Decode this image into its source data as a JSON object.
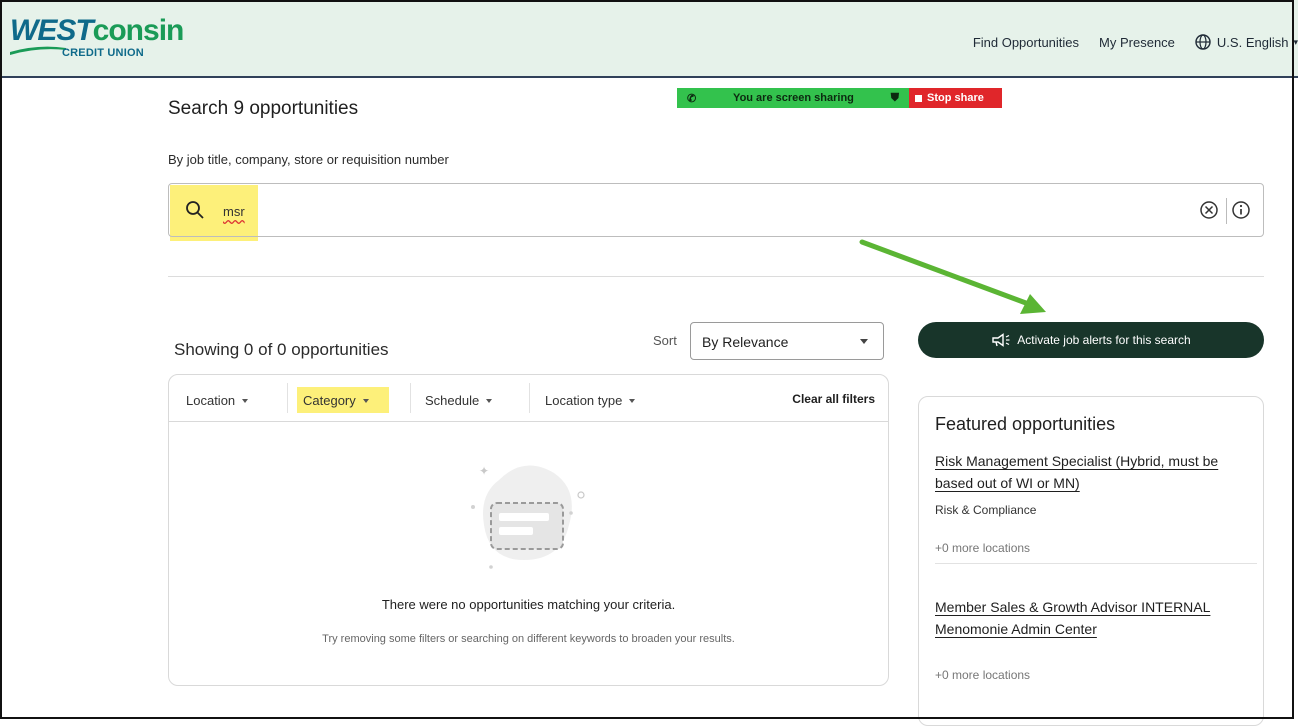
{
  "header": {
    "logo_main": "WEST",
    "logo_accent": "consin",
    "logo_sub": "CREDIT UNION",
    "nav": [
      "Find Opportunities",
      "My Presence"
    ],
    "language": "U.S. English"
  },
  "screen_share": {
    "status": "You are screen sharing",
    "stop": "Stop share"
  },
  "search": {
    "title": "Search 9 opportunities",
    "hint": "By job title, company, store or requisition number",
    "value": "msr"
  },
  "results": {
    "showing": "Showing 0 of 0 opportunities",
    "sort_label": "Sort",
    "sort_value": "By Relevance",
    "alerts_button": "Activate job alerts for this search",
    "filters": [
      "Location",
      "Category",
      "Schedule",
      "Location type"
    ],
    "clear_filters": "Clear all filters",
    "empty_title": "There were no opportunities matching your criteria.",
    "empty_sub": "Try removing some filters or searching on different keywords to broaden your results."
  },
  "featured": {
    "heading": "Featured opportunities",
    "jobs": [
      {
        "title": "Risk Management Specialist (Hybrid, must be based out of WI or MN)",
        "category": "Risk & Compliance",
        "locations": "+0 more locations"
      },
      {
        "title": "Member Sales & Growth Advisor INTERNAL Menomonie Admin Center",
        "locations": "+0 more locations"
      }
    ]
  },
  "colors": {
    "header_bg": "#e6f2ea",
    "brand_blue": "#0f6a8a",
    "brand_green": "#1a9b57",
    "button_dark": "#18352a",
    "highlight": "#fdf07a",
    "annotation_arrow": "#5bb534",
    "share_green": "#33c24d",
    "share_red": "#e0262a"
  }
}
